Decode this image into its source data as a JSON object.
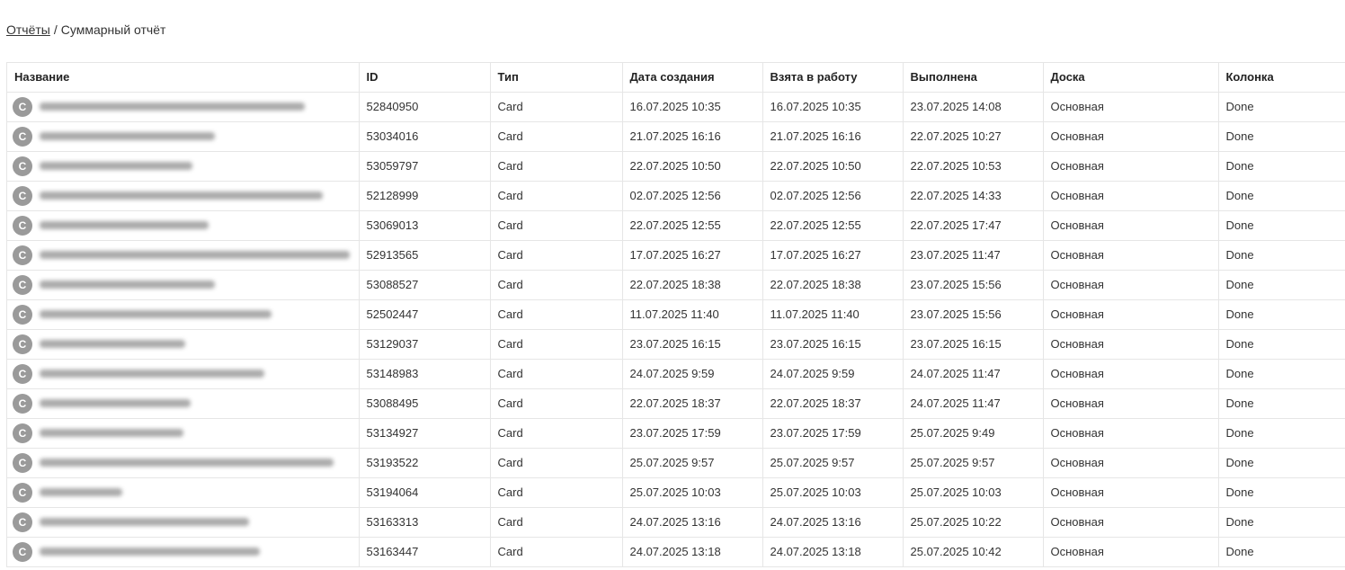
{
  "breadcrumb": {
    "parent": "Отчёты",
    "separator": "/",
    "current": "Суммарный отчёт"
  },
  "table": {
    "columns": [
      "Название",
      "ID",
      "Тип",
      "Дата создания",
      "Взята в работу",
      "Выполнена",
      "Доска",
      "Колонка"
    ],
    "rows": [
      {
        "avatar": "C",
        "id": "52840950",
        "type": "Card",
        "created": "16.07.2025 10:35",
        "taken": "16.07.2025 10:35",
        "done": "23.07.2025 14:08",
        "board": "Основная",
        "column": "Done"
      },
      {
        "avatar": "C",
        "id": "53034016",
        "type": "Card",
        "created": "21.07.2025 16:16",
        "taken": "21.07.2025 16:16",
        "done": "22.07.2025 10:27",
        "board": "Основная",
        "column": "Done"
      },
      {
        "avatar": "C",
        "id": "53059797",
        "type": "Card",
        "created": "22.07.2025 10:50",
        "taken": "22.07.2025 10:50",
        "done": "22.07.2025 10:53",
        "board": "Основная",
        "column": "Done"
      },
      {
        "avatar": "C",
        "id": "52128999",
        "type": "Card",
        "created": "02.07.2025 12:56",
        "taken": "02.07.2025 12:56",
        "done": "22.07.2025 14:33",
        "board": "Основная",
        "column": "Done"
      },
      {
        "avatar": "C",
        "id": "53069013",
        "type": "Card",
        "created": "22.07.2025 12:55",
        "taken": "22.07.2025 12:55",
        "done": "22.07.2025 17:47",
        "board": "Основная",
        "column": "Done"
      },
      {
        "avatar": "C",
        "id": "52913565",
        "type": "Card",
        "created": "17.07.2025 16:27",
        "taken": "17.07.2025 16:27",
        "done": "23.07.2025 11:47",
        "board": "Основная",
        "column": "Done"
      },
      {
        "avatar": "C",
        "id": "53088527",
        "type": "Card",
        "created": "22.07.2025 18:38",
        "taken": "22.07.2025 18:38",
        "done": "23.07.2025 15:56",
        "board": "Основная",
        "column": "Done"
      },
      {
        "avatar": "C",
        "id": "52502447",
        "type": "Card",
        "created": "11.07.2025 11:40",
        "taken": "11.07.2025 11:40",
        "done": "23.07.2025 15:56",
        "board": "Основная",
        "column": "Done"
      },
      {
        "avatar": "C",
        "id": "53129037",
        "type": "Card",
        "created": "23.07.2025 16:15",
        "taken": "23.07.2025 16:15",
        "done": "23.07.2025 16:15",
        "board": "Основная",
        "column": "Done"
      },
      {
        "avatar": "C",
        "id": "53148983",
        "type": "Card",
        "created": "24.07.2025 9:59",
        "taken": "24.07.2025 9:59",
        "done": "24.07.2025 11:47",
        "board": "Основная",
        "column": "Done"
      },
      {
        "avatar": "C",
        "id": "53088495",
        "type": "Card",
        "created": "22.07.2025 18:37",
        "taken": "22.07.2025 18:37",
        "done": "24.07.2025 11:47",
        "board": "Основная",
        "column": "Done"
      },
      {
        "avatar": "C",
        "id": "53134927",
        "type": "Card",
        "created": "23.07.2025 17:59",
        "taken": "23.07.2025 17:59",
        "done": "25.07.2025 9:49",
        "board": "Основная",
        "column": "Done"
      },
      {
        "avatar": "C",
        "id": "53193522",
        "type": "Card",
        "created": "25.07.2025 9:57",
        "taken": "25.07.2025 9:57",
        "done": "25.07.2025 9:57",
        "board": "Основная",
        "column": "Done"
      },
      {
        "avatar": "C",
        "id": "53194064",
        "type": "Card",
        "created": "25.07.2025 10:03",
        "taken": "25.07.2025 10:03",
        "done": "25.07.2025 10:03",
        "board": "Основная",
        "column": "Done"
      },
      {
        "avatar": "C",
        "id": "53163313",
        "type": "Card",
        "created": "24.07.2025 13:16",
        "taken": "24.07.2025 13:16",
        "done": "25.07.2025 10:22",
        "board": "Основная",
        "column": "Done"
      },
      {
        "avatar": "C",
        "id": "53163447",
        "type": "Card",
        "created": "24.07.2025 13:18",
        "taken": "24.07.2025 13:18",
        "done": "25.07.2025 10:42",
        "board": "Основная",
        "column": "Done"
      }
    ]
  },
  "colors": {
    "avatar_bg": "#9a9a9a",
    "border": "#e6e6e6",
    "text": "#333333"
  }
}
